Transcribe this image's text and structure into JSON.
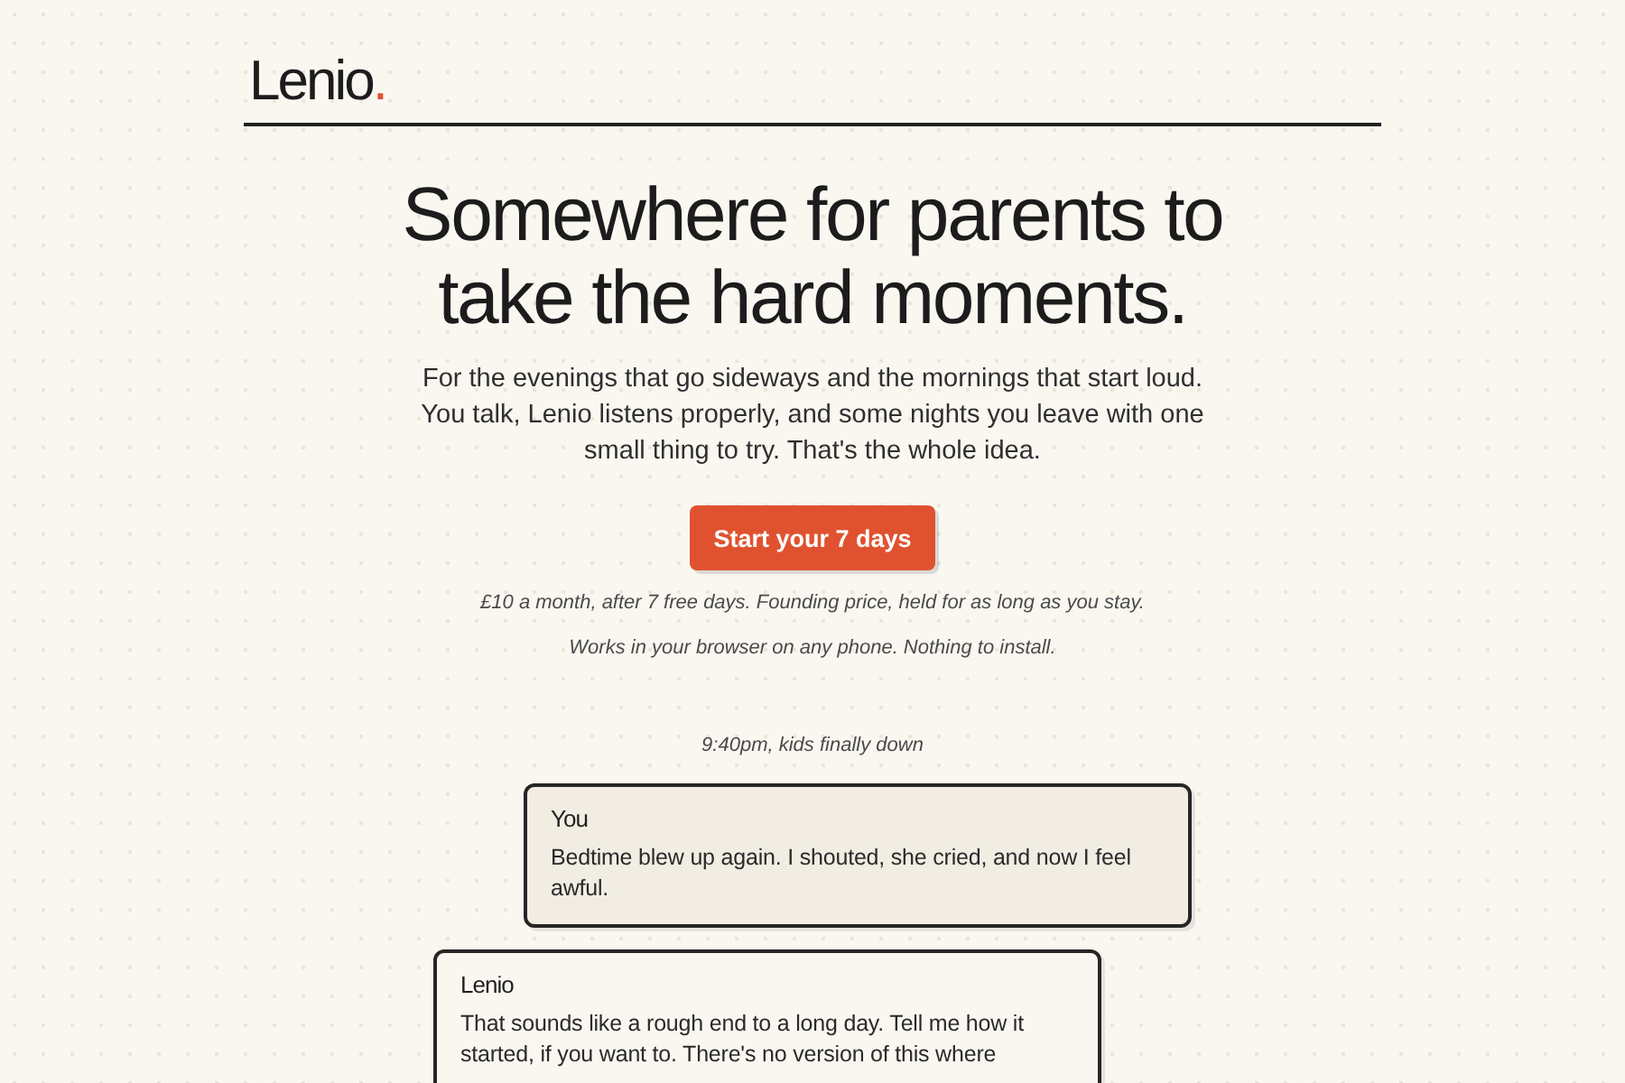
{
  "logo": {
    "name": "Lenio",
    "dot": "."
  },
  "hero": {
    "heading": "Somewhere for parents to take the hard moments.",
    "description": "For the evenings that go sideways and the mornings that start loud. You talk, Lenio listens properly, and some nights you leave with one small thing to try. That's the whole idea.",
    "button": "Start your 7 days",
    "notes": [
      "£10 a month, after 7 free days. Founding price, held for as long as you stay.",
      "Works in your browser on any phone. Nothing to install."
    ]
  },
  "chat": {
    "timestamp": "9:40pm, kids finally down",
    "messages": [
      {
        "kind": "user",
        "sender": "You",
        "text": "Bedtime blew up again. I shouted, she cried, and now I feel awful."
      },
      {
        "kind": "assistant",
        "sender": "Lenio",
        "text": "That sounds like a rough end to a long day. Tell me how it started, if you want to. There's no version of this where"
      }
    ]
  }
}
